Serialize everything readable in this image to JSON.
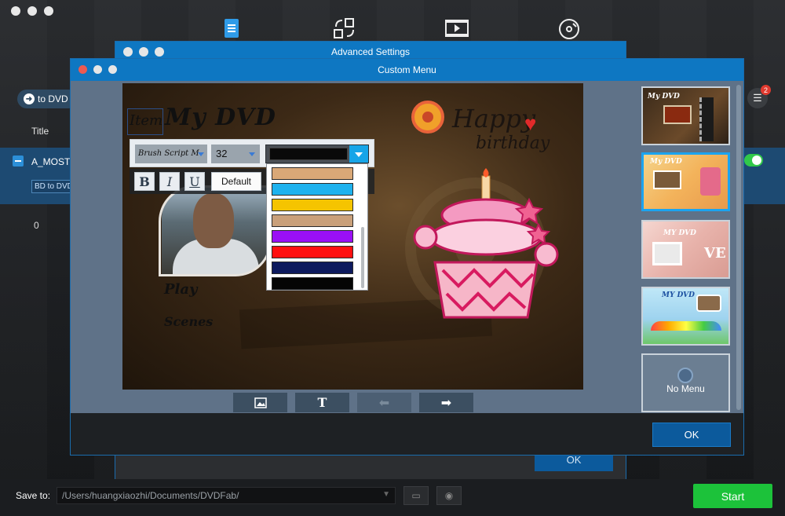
{
  "app": {
    "to_dvd_label": "to DVD",
    "column_title": "Title",
    "row_name": "A_MOST",
    "row_tag": "BD to DVD",
    "row_value": "0",
    "notifications_count": "2"
  },
  "bottom": {
    "save_label": "Save to:",
    "save_path": "/Users/huangxiaozhi/Documents/DVDFab/",
    "start_label": "Start"
  },
  "advanced_settings": {
    "title": "Advanced Settings",
    "ok_label": "OK"
  },
  "custom_menu": {
    "title": "Custom Menu",
    "ok_label": "OK",
    "canvas": {
      "title_text": "My DVD",
      "item_box_text": "Item",
      "menu_items": [
        "Play",
        "Scenes"
      ],
      "happy_text": "Happy",
      "birthday_text": "birthday"
    },
    "toolbar": {
      "font_value": "Brush Script M",
      "size_value": "32",
      "bold_label": "B",
      "italic_label": "I",
      "underline_label": "U",
      "default_label": "Default"
    },
    "color_options": [
      "#d9a877",
      "#1eb2ee",
      "#f5c400",
      "#c9a07a",
      "#9a10f5",
      "#ff1010",
      "#0d1a5e",
      "#050505"
    ],
    "canvas_buttons": [
      "image-icon",
      "text-icon",
      "arrow-left-icon",
      "arrow-right-icon"
    ],
    "templates": [
      {
        "label": "My DVD",
        "selected": false
      },
      {
        "label": "My DVD",
        "selected": true
      },
      {
        "label": "MY DVD",
        "selected": false
      },
      {
        "label": "MY DVD",
        "selected": false
      },
      {
        "label": "No Menu",
        "selected": false
      }
    ]
  },
  "colors": {
    "accent": "#0e77c2",
    "start": "#1cc23a",
    "selected_border": "#1ba4f0"
  }
}
